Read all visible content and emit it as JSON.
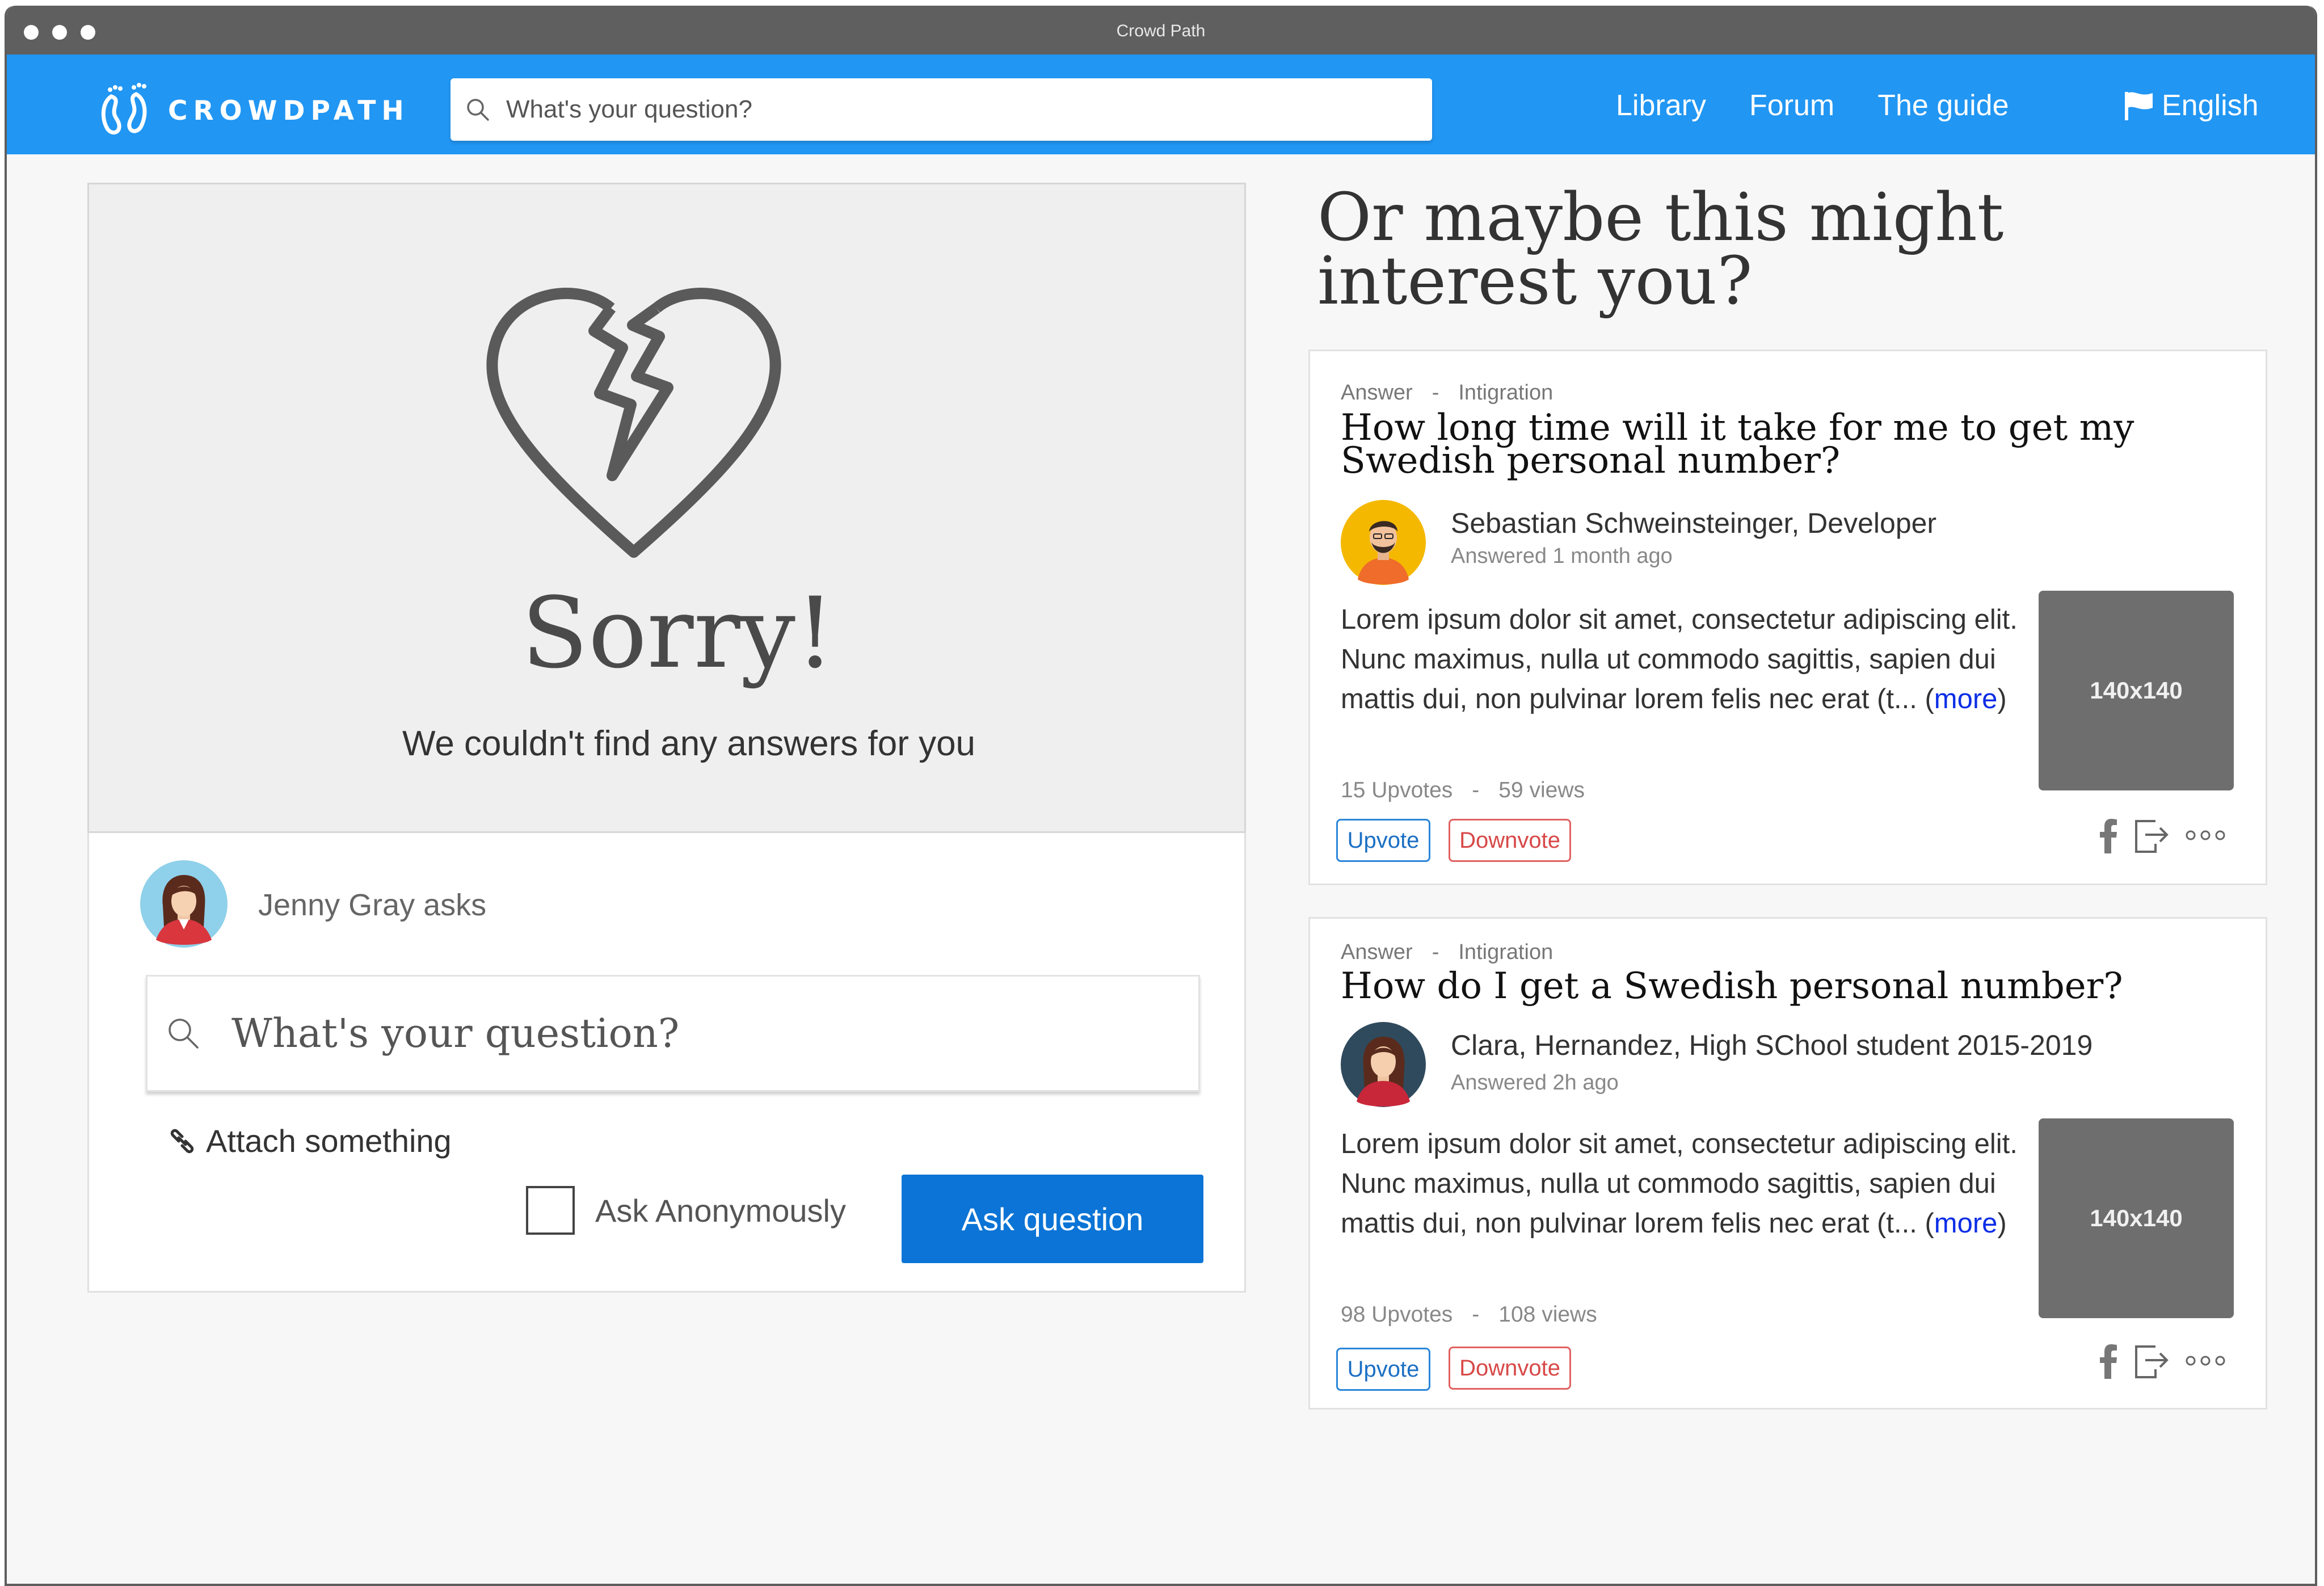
{
  "window": {
    "title": "Crowd Path"
  },
  "navbar": {
    "logo_text": "CROWDPATH",
    "search_placeholder": "What's your question?",
    "links": [
      "Library",
      "Forum",
      "The guide"
    ],
    "language": "English"
  },
  "sorry": {
    "title": "Sorry!",
    "subtitle": "We couldn't find any answers for you"
  },
  "ask": {
    "asker": "Jenny Gray asks",
    "question_placeholder": "What's your question?",
    "attach_label": "Attach something",
    "anonymous_label": "Ask Anonymously",
    "submit_label": "Ask question"
  },
  "suggestions": {
    "title": "Or maybe this might interest you?",
    "cards": [
      {
        "type": "Answer",
        "sep": "-",
        "category": "Intigration",
        "title": "How long time will it take for me to get my Swedish personal number?",
        "author": "Sebastian Schweinsteinger, Developer",
        "time": "Answered 1 month ago",
        "body": "Lorem ipsum dolor sit amet, consectetur adipiscing elit. Nunc maximus, nulla ut commodo sagittis, sapien dui mattis dui, non pulvinar lorem felis nec erat (t... ",
        "more_open": "(",
        "more": "more",
        "more_close": ")",
        "thumb": "140x140",
        "upvotes": "15 Upvotes",
        "stats_sep": "-",
        "views": "59 views",
        "upvote_label": "Upvote",
        "downvote_label": "Downvote"
      },
      {
        "type": "Answer",
        "sep": "-",
        "category": "Intigration",
        "title": "How do I get a Swedish personal number?",
        "author": "Clara, Hernandez, High SChool student 2015-2019",
        "time": "Answered 2h ago",
        "body": "Lorem ipsum dolor sit amet, consectetur adipiscing elit. Nunc maximus, nulla ut commodo sagittis, sapien dui mattis dui, non pulvinar lorem felis nec erat (t... ",
        "more_open": "(",
        "more": "more",
        "more_close": ")",
        "thumb": "140x140",
        "upvotes": "98 Upvotes",
        "stats_sep": "-",
        "views": "108 views",
        "upvote_label": "Upvote",
        "downvote_label": "Downvote"
      }
    ]
  },
  "colors": {
    "primary": "#2196f3",
    "button": "#0b74d6",
    "upvote": "#2a86d8",
    "downvote": "#e06262",
    "link": "#0b2ee6"
  }
}
